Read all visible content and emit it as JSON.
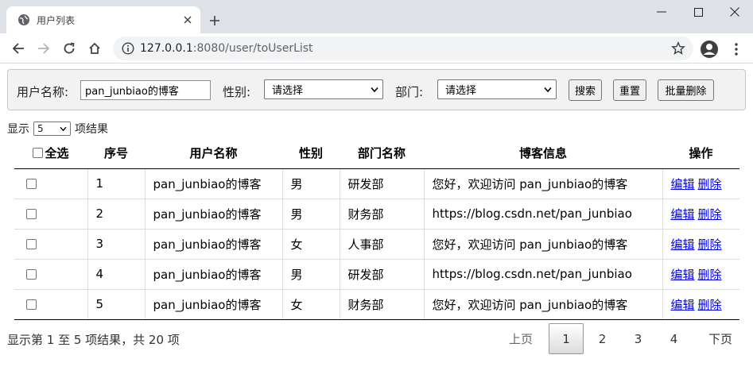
{
  "browser": {
    "tab_title": "用户列表",
    "url_host": "127.0.0.1",
    "url_path": ":8080/user/toUserList"
  },
  "search": {
    "username_label": "用户名称:",
    "username_value": "pan_junbiao的博客",
    "gender_label": "性别:",
    "gender_selected": "请选择",
    "dept_label": "部门:",
    "dept_selected": "请选择",
    "search_btn": "搜索",
    "reset_btn": "重置",
    "batch_delete_btn": "批量删除"
  },
  "page_size": {
    "prefix": "显示",
    "value": "5",
    "suffix": "项结果"
  },
  "table": {
    "headers": {
      "select_all": "全选",
      "index": "序号",
      "username": "用户名称",
      "gender": "性别",
      "dept": "部门名称",
      "blog": "博客信息",
      "actions": "操作"
    },
    "rows": [
      {
        "index": "1",
        "username": "pan_junbiao的博客",
        "gender": "男",
        "dept": "研发部",
        "blog": "您好，欢迎访问 pan_junbiao的博客"
      },
      {
        "index": "2",
        "username": "pan_junbiao的博客",
        "gender": "男",
        "dept": "财务部",
        "blog": "https://blog.csdn.net/pan_junbiao"
      },
      {
        "index": "3",
        "username": "pan_junbiao的博客",
        "gender": "女",
        "dept": "人事部",
        "blog": "您好，欢迎访问 pan_junbiao的博客"
      },
      {
        "index": "4",
        "username": "pan_junbiao的博客",
        "gender": "男",
        "dept": "研发部",
        "blog": "https://blog.csdn.net/pan_junbiao"
      },
      {
        "index": "5",
        "username": "pan_junbiao的博客",
        "gender": "女",
        "dept": "财务部",
        "blog": "您好，欢迎访问 pan_junbiao的博客"
      }
    ],
    "edit_label": "编辑",
    "delete_label": "删除"
  },
  "footer": {
    "result_info": "显示第 1 至 5 项结果，共 20 项",
    "prev": "上页",
    "pages": [
      "1",
      "2",
      "3",
      "4"
    ],
    "current_page": "1",
    "next": "下页"
  },
  "colors": {
    "link": "#0000ee",
    "panel_bg": "#f2f2f2",
    "chrome_bg": "#dee1e6"
  }
}
